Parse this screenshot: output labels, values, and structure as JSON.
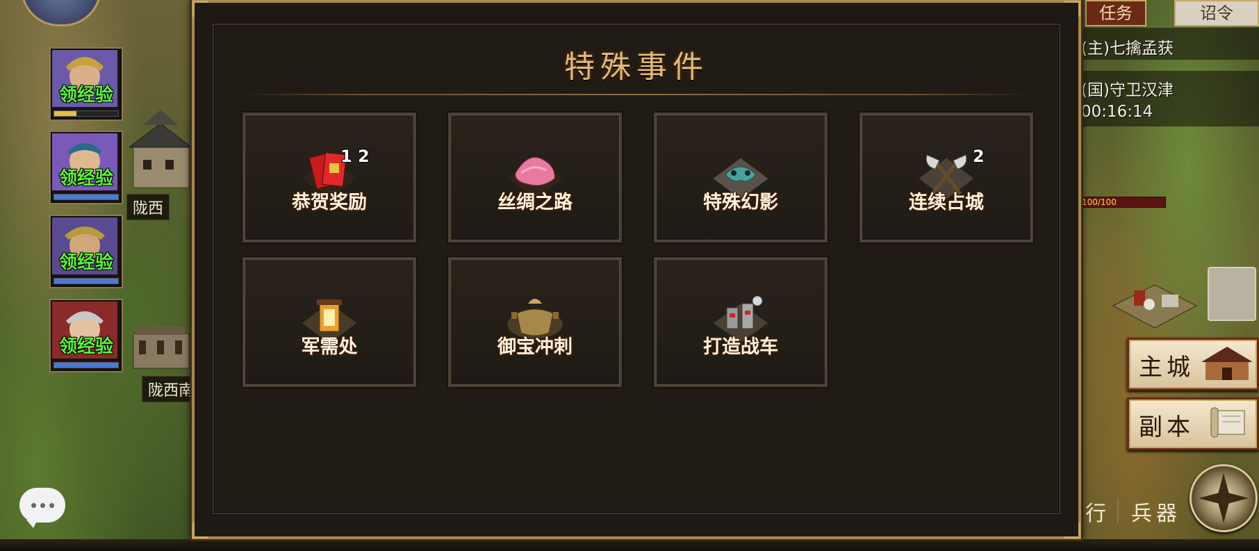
{
  "modal": {
    "title": "特殊事件",
    "events": [
      {
        "label": "恭贺奖励",
        "badge": "1 2",
        "icon": "red-envelope-icon"
      },
      {
        "label": "丝绸之路",
        "badge": "",
        "icon": "silk-cloth-icon"
      },
      {
        "label": "特殊幻影",
        "badge": "",
        "icon": "phantom-mask-icon"
      },
      {
        "label": "连续占城",
        "badge": "2",
        "icon": "crossed-axes-icon"
      },
      {
        "label": "军需处",
        "badge": "",
        "icon": "lantern-icon"
      },
      {
        "label": "御宝冲刺",
        "badge": "",
        "icon": "treasure-cauldron-icon"
      },
      {
        "label": "打造战车",
        "badge": "",
        "icon": "war-chariot-icon"
      }
    ]
  },
  "left_hud": {
    "heroes": [
      {
        "exp_label": "领经验",
        "bar_color": "#e0c040",
        "bar_fill": 0.35
      },
      {
        "exp_label": "领经验",
        "bar_color": "#4a7ad8",
        "bar_fill": 1.0
      },
      {
        "exp_label": "领经验",
        "bar_color": "#4a7ad8",
        "bar_fill": 1.0
      },
      {
        "exp_label": "领经验",
        "bar_color": "#4a7ad8",
        "bar_fill": 1.0
      }
    ],
    "city_labels": [
      "陇西",
      "陇西南"
    ]
  },
  "right_hud": {
    "tabs": [
      "任务",
      "诏令"
    ],
    "quests": [
      "(主)七擒孟获",
      "(国)守卫汉津",
      "00:16:14"
    ],
    "hp_text": "100/100",
    "buttons": [
      "主城",
      "副本"
    ],
    "bottom_partial": "行",
    "bottom_label": "兵器"
  },
  "colors": {
    "gold_title": "#e2b97a",
    "exp_green": "#5cf23a",
    "frame_gold": "#a9894e"
  }
}
